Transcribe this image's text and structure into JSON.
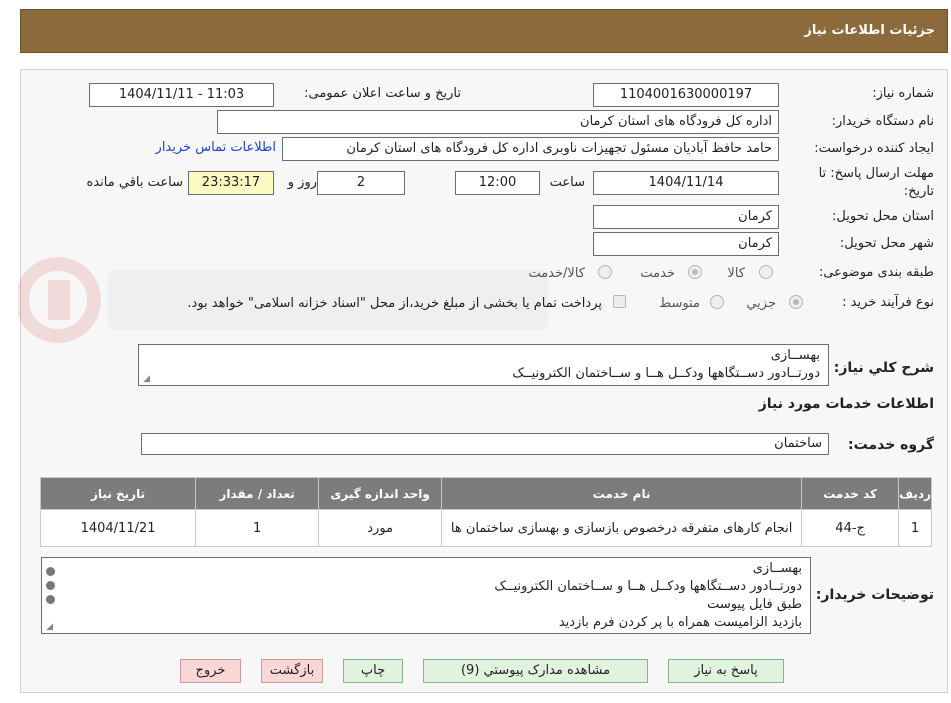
{
  "header": {
    "title": "جزئیات اطلاعات نیاز"
  },
  "form": {
    "need_number_label": "شماره نیاز:",
    "need_number": "1104001630000197",
    "announce_label": "تاریخ و ساعت اعلان عمومی:",
    "announce_value": "1404/11/11 - 11:03",
    "buyer_label": "نام دستگاه خریدار:",
    "buyer_value": "اداره کل فرودگاه های استان کرمان",
    "creator_label": "ایجاد کننده درخواست:",
    "creator_value": "حامد حافظ آبادیان مسئول تجهیزات ناوبری اداره کل فرودگاه های استان کرمان",
    "contact_link": "اطلاعات تماس خریدار",
    "deadline_label_1": "مهلت ارسال پاسخ: تا",
    "deadline_label_2": "تاریخ:",
    "deadline_date": "1404/11/14",
    "time_label": "ساعت",
    "deadline_time": "12:00",
    "days_value": "2",
    "days_label": "روز و",
    "remaining_time": "23:33:17",
    "remaining_label": "ساعت باقي مانده",
    "province_label": "استان محل تحویل:",
    "province_value": "کرمان",
    "city_label": "شهر محل تحویل:",
    "city_value": "کرمان",
    "category_label": "طبقه بندی موضوعی:",
    "category_options": [
      "کالا",
      "خدمت",
      "کالا/خدمت"
    ],
    "category_selected": "خدمت",
    "process_label": "نوع فرآیند خرید :",
    "process_options": [
      "جزیي",
      "متوسط"
    ],
    "payment_note": "پرداخت تمام یا بخشی از مبلغ خرید،از محل \"اسناد خزانه اسلامی\" خواهد بود."
  },
  "description": {
    "label": "شرح کلي نیاز:",
    "lines": [
      "بهســازی",
      "دورتــادور دســتگاهها ودکــل هــا و ســاختمان الکترونیــک"
    ]
  },
  "services_section": {
    "title": "اطلاعات خدمات مورد نیاز",
    "group_label": "گروه خدمت:",
    "group_value": "ساختمان"
  },
  "table": {
    "headers": [
      "ردیف",
      "کد خدمت",
      "نام خدمت",
      "واحد اندازه گیری",
      "تعداد / مقدار",
      "تاریخ نیاز"
    ],
    "rows": [
      [
        "1",
        "ج-44",
        "انجام کارهای متفرقه درخصوص بازسازی و بهسازی ساختمان ها",
        "مورد",
        "1",
        "1404/11/21"
      ]
    ]
  },
  "buyer_notes": {
    "label": "توضیحات خریدار:",
    "lines": [
      "بهســازی",
      "دورتــادور دســتگاهها ودکــل هــا و ســاختمان الکترونیــک",
      "طبق فایل پیوست",
      "بازدید الزامیست همراه با پر کردن فرم بازدید"
    ]
  },
  "buttons": {
    "reply": "پاسخ به نیاز",
    "attachments": "مشاهده مدارک پیوستي (9)",
    "print": "چاپ",
    "back": "بازگشت",
    "exit": "خروج"
  },
  "colors": {
    "header_bg": "#8c6a3c",
    "table_header_bg": "#7c7c7c",
    "link": "#1a44c8",
    "button_green": "#dff3df",
    "button_red": "#f9d7d7"
  }
}
